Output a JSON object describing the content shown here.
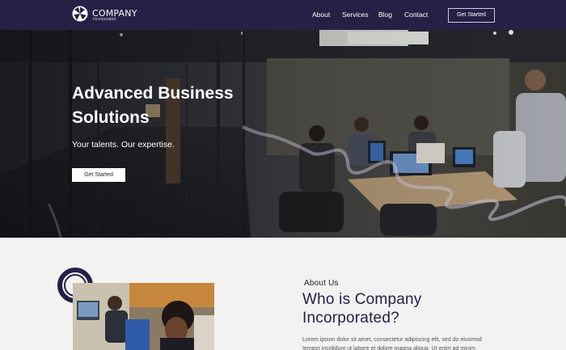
{
  "header": {
    "brand": "COMPANY",
    "brand_sub": "Incorporated",
    "logo_icon": "aperture-logo-icon",
    "nav": [
      {
        "label": "About"
      },
      {
        "label": "Services"
      },
      {
        "label": "Blog"
      },
      {
        "label": "Contact"
      }
    ],
    "cta": "Get Started"
  },
  "hero": {
    "title": "Advanced Business Solutions",
    "subtitle": "Your talents. Our expertise.",
    "cta": "Get Started"
  },
  "about": {
    "eyebrow": "About Us",
    "title": "Who is Company Incorporated?",
    "body": "Lorem ipsum dolor sit amet, consectetur adipiscing elit, sed do eiusmod tempor incididunt ut labore et dolore magna aliqua. Ut enim ad minim"
  },
  "colors": {
    "brand_navy": "#262046",
    "page_bg": "#f2f2f2",
    "white": "#ffffff"
  }
}
